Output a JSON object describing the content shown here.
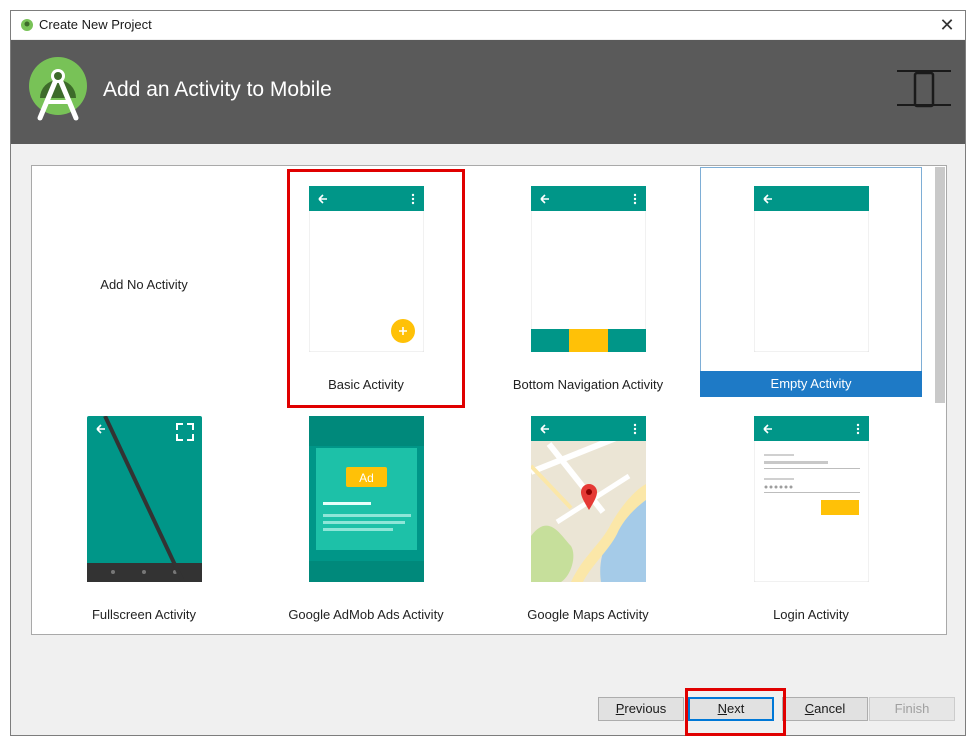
{
  "window": {
    "title": "Create New Project",
    "close_symbol": "✕"
  },
  "banner": {
    "heading": "Add an Activity to Mobile"
  },
  "activities": [
    {
      "label": "Add No Activity"
    },
    {
      "label": "Basic Activity"
    },
    {
      "label": "Bottom Navigation Activity"
    },
    {
      "label": "Empty Activity",
      "selected": true
    },
    {
      "label": "Fullscreen Activity"
    },
    {
      "label": "Google AdMob Ads Activity",
      "ad_badge": "Ad"
    },
    {
      "label": "Google Maps Activity"
    },
    {
      "label": "Login Activity"
    }
  ],
  "colors": {
    "teal": "#009688",
    "dark_teal": "#00796b",
    "accent": "#ffc107",
    "selection": "#1e7ac6",
    "highlight": "#e00000"
  },
  "buttons": {
    "previous": {
      "underline": "P",
      "rest": "revious"
    },
    "next": {
      "underline": "N",
      "rest": "ext"
    },
    "cancel": {
      "underline": "C",
      "rest": "ancel"
    },
    "finish": {
      "label": "Finish"
    }
  }
}
